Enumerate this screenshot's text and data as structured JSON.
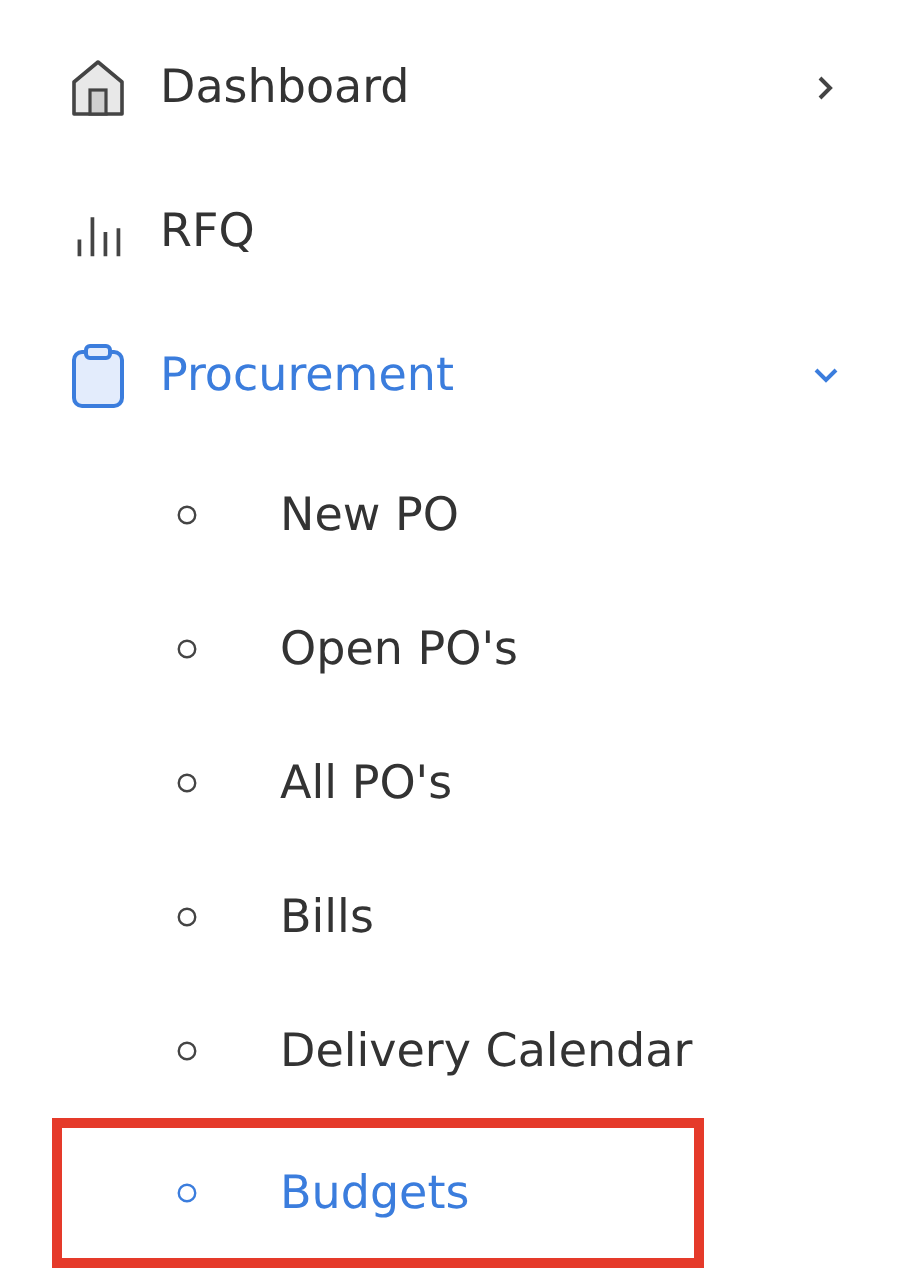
{
  "sidebar": {
    "items": [
      {
        "label": "Dashboard",
        "kind": "group",
        "selected": false,
        "expanded": false
      },
      {
        "label": "RFQ",
        "kind": "link",
        "selected": false
      },
      {
        "label": "Procurement",
        "kind": "group",
        "selected": true,
        "expanded": true,
        "children": [
          {
            "label": "New PO",
            "selected": false,
            "highlighted": false
          },
          {
            "label": "Open PO's",
            "selected": false,
            "highlighted": false
          },
          {
            "label": "All PO's",
            "selected": false,
            "highlighted": false
          },
          {
            "label": "Bills",
            "selected": false,
            "highlighted": false
          },
          {
            "label": "Delivery Calendar",
            "selected": false,
            "highlighted": false
          },
          {
            "label": "Budgets",
            "selected": true,
            "highlighted": true
          }
        ]
      }
    ]
  }
}
